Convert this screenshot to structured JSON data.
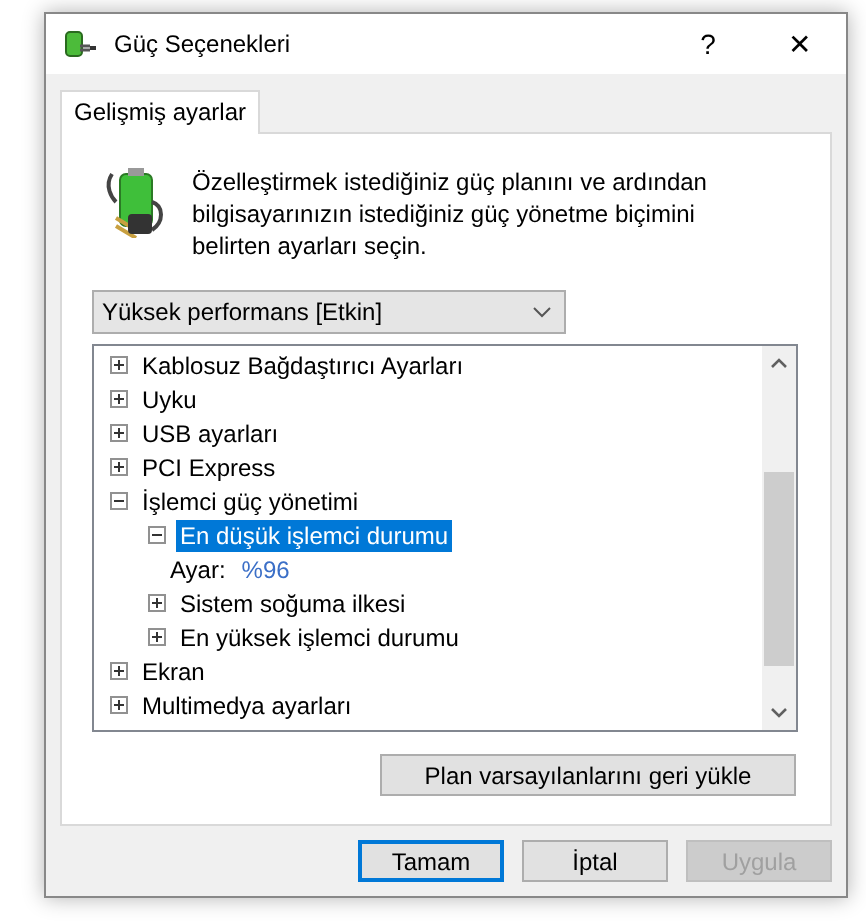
{
  "window": {
    "title": "Güç Seçenekleri",
    "help": "?",
    "close": "✕"
  },
  "tabs": [
    {
      "label": "Gelişmiş ayarlar",
      "selected": true
    }
  ],
  "description": "Özelleştirmek istediğiniz güç planını ve ardından bilgisayarınızın istediğiniz güç yönetme biçimini belirten ayarları seçin.",
  "plan_dropdown": {
    "value": "Yüksek performans [Etkin]"
  },
  "tree": [
    {
      "kind": "node",
      "label": "Kablosuz Bağdaştırıcı Ayarları",
      "expanded": false,
      "selected": false
    },
    {
      "kind": "node",
      "label": "Uyku",
      "expanded": false,
      "selected": false
    },
    {
      "kind": "node",
      "label": "USB ayarları",
      "expanded": false,
      "selected": false
    },
    {
      "kind": "node",
      "label": "PCI Express",
      "expanded": false,
      "selected": false
    },
    {
      "kind": "node",
      "label": "İşlemci güç yönetimi",
      "expanded": true,
      "selected": false,
      "children": [
        {
          "kind": "node",
          "label": "En düşük işlemci durumu",
          "expanded": true,
          "selected": true,
          "children": [
            {
              "kind": "setting",
              "label": "Ayar:",
              "value": "%96"
            }
          ]
        },
        {
          "kind": "node",
          "label": "Sistem soğuma ilkesi",
          "expanded": false,
          "selected": false
        },
        {
          "kind": "node",
          "label": "En yüksek işlemci durumu",
          "expanded": false,
          "selected": false
        }
      ]
    },
    {
      "kind": "node",
      "label": "Ekran",
      "expanded": false,
      "selected": false
    },
    {
      "kind": "node",
      "label": "Multimedya ayarları",
      "expanded": false,
      "selected": false
    }
  ],
  "restore_button": "Plan varsayılanlarını geri yükle",
  "buttons": [
    {
      "label": "Tamam",
      "default": true,
      "disabled": false
    },
    {
      "label": "İptal",
      "default": false,
      "disabled": false
    },
    {
      "label": "Uygula",
      "default": false,
      "disabled": true
    }
  ]
}
